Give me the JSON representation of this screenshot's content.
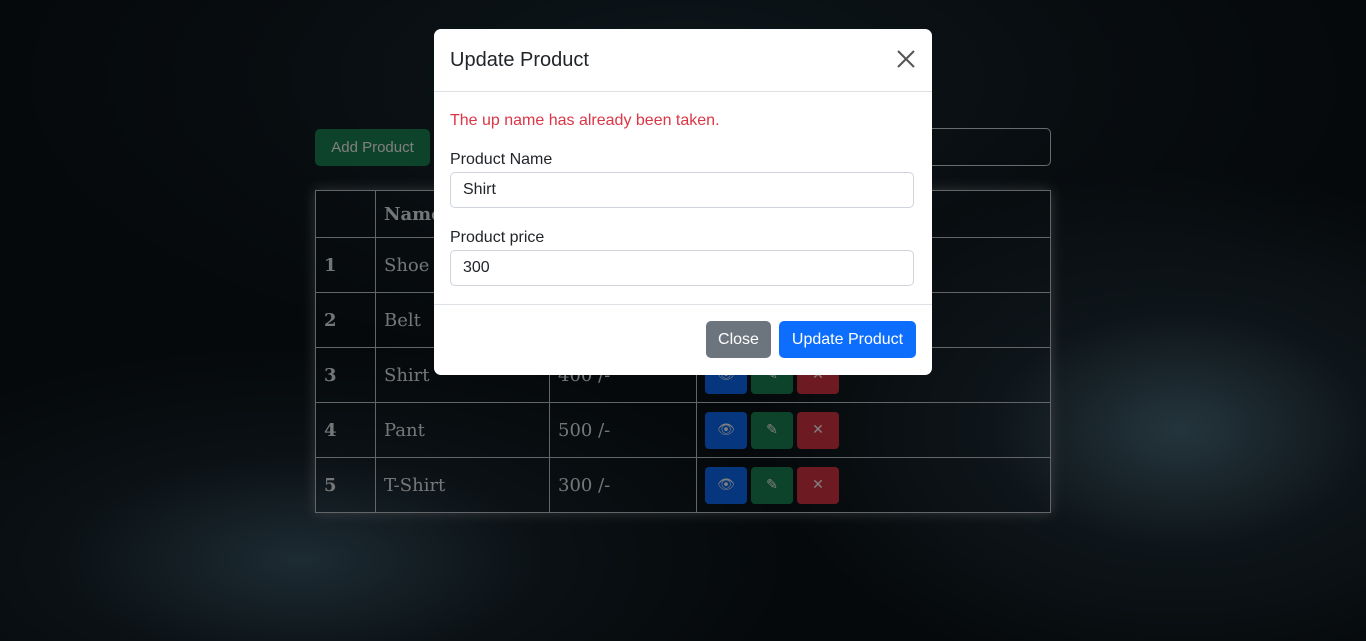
{
  "app": {
    "add_product_label": "Add Product"
  },
  "table": {
    "headers": [
      "",
      "Name",
      "",
      ""
    ],
    "rows": [
      {
        "id": "1",
        "name": "Shoe",
        "price": ""
      },
      {
        "id": "2",
        "name": "Belt",
        "price": ""
      },
      {
        "id": "3",
        "name": "Shirt",
        "price": "400 /-"
      },
      {
        "id": "4",
        "name": "Pant",
        "price": "500 /-"
      },
      {
        "id": "5",
        "name": "T-Shirt",
        "price": "300 /-"
      }
    ],
    "action_icons": {
      "view": "eye-icon",
      "edit": "edit-icon",
      "delete": "close-icon"
    }
  },
  "modal": {
    "title": "Update Product",
    "error": "The up name has already been taken.",
    "name_label": "Product Name",
    "name_value": "Shirt",
    "price_label": "Product price",
    "price_value": "300",
    "close_label": "Close",
    "update_label": "Update Product"
  },
  "colors": {
    "primary": "#0d6efd",
    "success": "#198754",
    "danger": "#dc3545",
    "secondary": "#6c757d"
  }
}
